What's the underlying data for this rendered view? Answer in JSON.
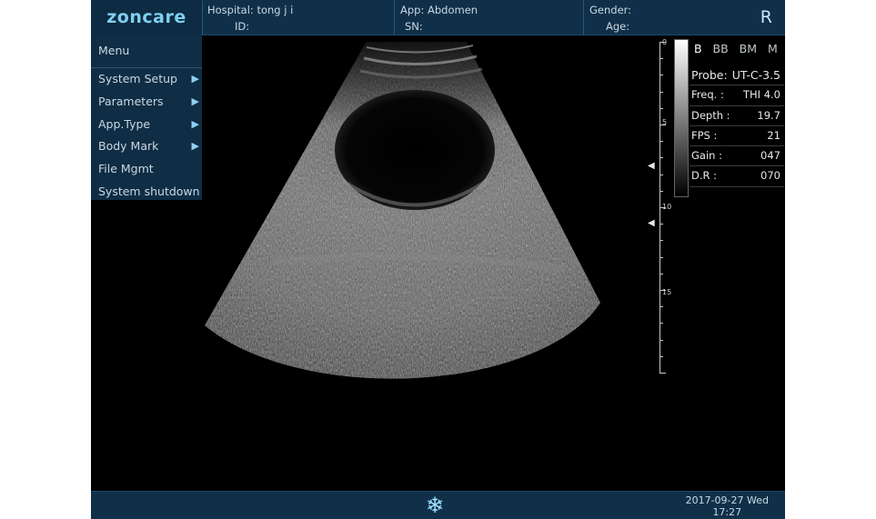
{
  "header": {
    "logo": "zoncare",
    "hospital_label": "Hospital:",
    "hospital_value": "tong j i",
    "id_label": "ID:",
    "app_label": "App:",
    "app_value": "Abdomen",
    "sn_label": "SN:",
    "gender_label": "Gender:",
    "age_label": "Age:",
    "side": "R"
  },
  "menu": {
    "title": "Menu",
    "items": [
      {
        "label": "System Setup",
        "has_submenu": true
      },
      {
        "label": "Parameters",
        "has_submenu": true
      },
      {
        "label": "App.Type",
        "has_submenu": true
      },
      {
        "label": "Body Mark",
        "has_submenu": true
      },
      {
        "label": "File Mgmt",
        "has_submenu": false
      },
      {
        "label": "System shutdown",
        "has_submenu": false
      }
    ],
    "arrow_glyph": "▶"
  },
  "scale": {
    "labels": [
      "0",
      "5",
      "10",
      "15"
    ],
    "focus_glyph": "◀"
  },
  "modes": {
    "b": "B",
    "bb": "BB",
    "bm": "BM",
    "m": "M",
    "active": "B"
  },
  "params": {
    "probe_label": "Probe:",
    "probe_value": "UT-C-3.5",
    "freq_label": "Freq.  :",
    "freq_value": "THI 4.0",
    "depth_label": "Depth  :",
    "depth_value": "19.7",
    "fps_label": "FPS   :",
    "fps_value": "21",
    "gain_label": "Gain  :",
    "gain_value": "047",
    "dr_label": "D.R   :",
    "dr_value": "070"
  },
  "footer": {
    "freeze_icon": "❄",
    "date": "2017-09-27 Wed",
    "time": "17:27"
  },
  "colors": {
    "bar_bg": "#103049",
    "logo_text": "#7fd0f0",
    "text": "#c9d8e4",
    "freeze": "#9fe0ff"
  }
}
